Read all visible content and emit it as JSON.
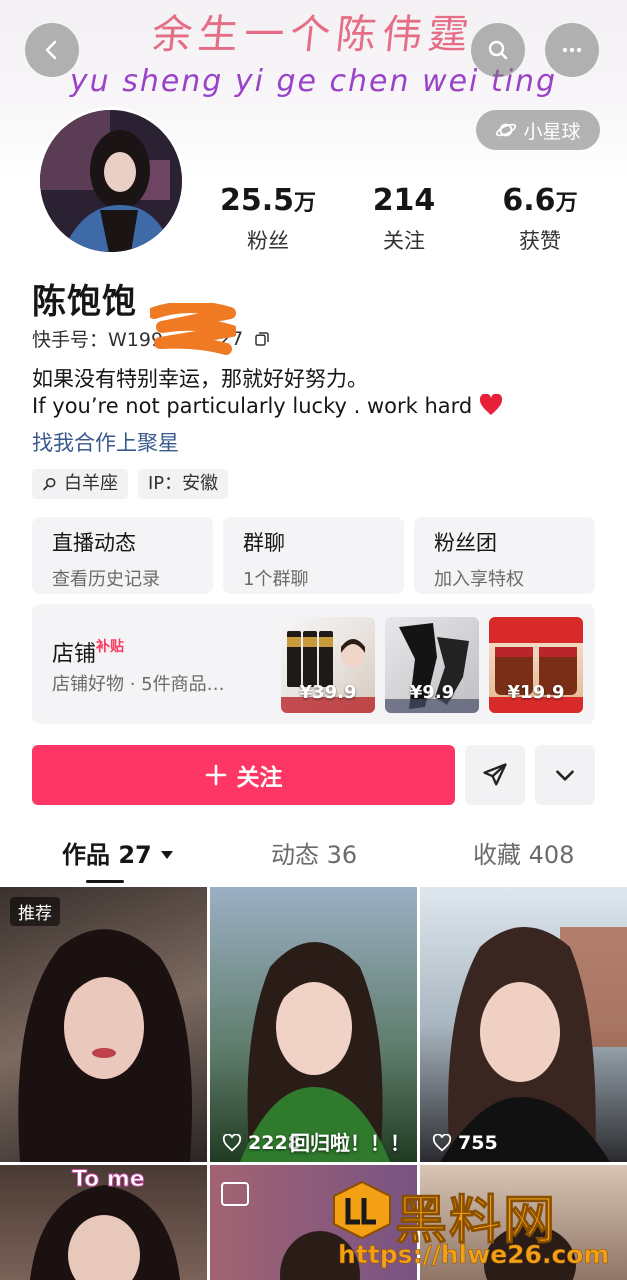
{
  "banner": {
    "title": "余生一个陈伟霆",
    "subtitle": "yu sheng yi ge chen wei ting"
  },
  "header": {
    "planet_label": "小星球"
  },
  "profile": {
    "name": "陈饱饱",
    "kuaishou_id": "快手号：W199",
    "kuaishou_id_tail": "27",
    "bio_line1": "如果没有特别幸运，那就好好努力。",
    "bio_line2": "If you’re not particularly lucky . work hard",
    "bio_link": "找我合作上聚星",
    "tags": [
      "白羊座",
      "IP：安徽"
    ]
  },
  "stats": [
    {
      "num": "25.5",
      "unit": "万",
      "label": "粉丝"
    },
    {
      "num": "214",
      "unit": "",
      "label": "关注"
    },
    {
      "num": "6.6",
      "unit": "万",
      "label": "获赞"
    }
  ],
  "cards": [
    {
      "title": "直播动态",
      "subtitle": "查看历史记录"
    },
    {
      "title": "群聊",
      "subtitle": "1个群聊"
    },
    {
      "title": "粉丝团",
      "subtitle": "加入享特权"
    }
  ],
  "shop": {
    "title": "店铺",
    "badge": "补贴",
    "subtitle": "店铺好物 · 5件商品…",
    "products": [
      {
        "price": "¥39.9"
      },
      {
        "price": "¥9.9"
      },
      {
        "price": "¥19.9"
      }
    ]
  },
  "actions": {
    "follow_label": "关注"
  },
  "tabs": [
    {
      "label": "作品 27"
    },
    {
      "label": "动态 36"
    },
    {
      "label": "收藏 408"
    }
  ],
  "grid": [
    {
      "badge": "推荐",
      "likes": "",
      "caption": ""
    },
    {
      "badge": "",
      "likes": "2228",
      "caption": "回归啦！！！"
    },
    {
      "badge": "",
      "likes": "755",
      "caption": ""
    },
    {
      "badge": "",
      "likes": "",
      "caption": "To me"
    }
  ],
  "watermark": {
    "title": "黑料网",
    "url": "https://hlwe26.com"
  },
  "colors": {
    "accent": "#fe3666",
    "link": "#3a5a8f",
    "banner_title": "#e56e86",
    "banner_subtitle": "#9a43c9"
  }
}
